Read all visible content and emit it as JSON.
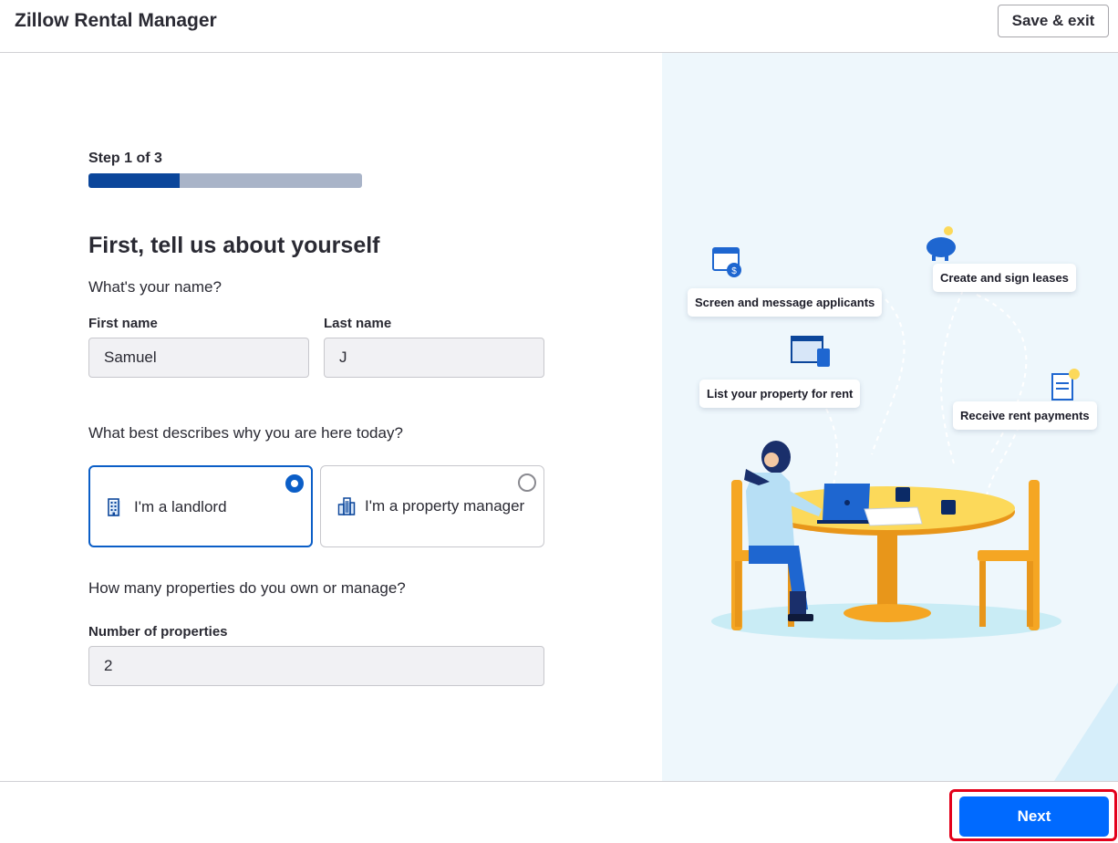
{
  "header": {
    "app_title": "Zillow Rental Manager",
    "save_exit_label": "Save & exit"
  },
  "progress": {
    "step_label": "Step 1 of 3",
    "fraction": 0.333
  },
  "form": {
    "heading": "First, tell us about yourself",
    "name_question": "What's your name?",
    "first_name": {
      "label": "First name",
      "value": "Samuel"
    },
    "last_name": {
      "label": "Last name",
      "value": "J"
    },
    "role_question": "What best describes why you are here today?",
    "roles": [
      {
        "label": "I'm a landlord",
        "selected": true,
        "icon": "building-icon"
      },
      {
        "label": "I'm a property manager",
        "selected": false,
        "icon": "buildings-icon"
      }
    ],
    "properties_question": "How many properties do you own or manage?",
    "properties": {
      "label": "Number of properties",
      "value": "2"
    }
  },
  "illustration": {
    "cards": [
      {
        "label": "Screen and message applicants",
        "icon": "calendar-dollar-icon"
      },
      {
        "label": "Create and sign leases",
        "icon": "piggy-bank-icon"
      },
      {
        "label": "List your property for rent",
        "icon": "listing-icon"
      },
      {
        "label": "Receive rent payments",
        "icon": "receipt-icon"
      }
    ]
  },
  "footer": {
    "next_label": "Next"
  },
  "colors": {
    "primary": "#006aff",
    "progress_fill": "#0b469b",
    "progress_track": "#a9b4c8",
    "selected_border": "#0b5ec7",
    "highlight": "#e3001b",
    "illustration_bg": "#eef7fc"
  }
}
